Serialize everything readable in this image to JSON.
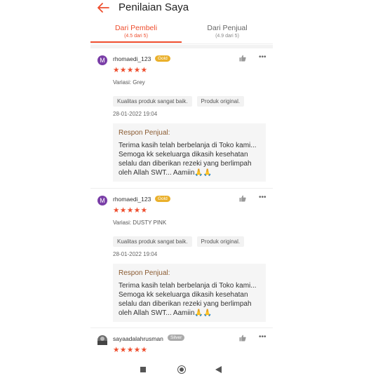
{
  "header": {
    "title": "Penilaian Saya"
  },
  "tabs": [
    {
      "label": "Dari Pembeli",
      "sub": "(4.5 dari 5)"
    },
    {
      "label": "Dari Penjual",
      "sub": "(4.9 dari 5)"
    }
  ],
  "colors": {
    "accent": "#ee4d2d",
    "gold": "#eab02b",
    "silver": "#aaaaaa"
  },
  "reviews": [
    {
      "avatar": "M",
      "user": "rhomaedi_123",
      "badge": "Gold",
      "stars": "★★★★★",
      "rating": 5,
      "variant": "Variasi: Grey",
      "tags": [
        "Kualitas produk sangat baik.",
        "Produk original."
      ],
      "date": "28-01-2022 19:04",
      "response_label": "Respon Penjual:",
      "response_text": "Terima kasih telah berbelanja di Toko kami... Semoga kk sekeluarga dikasih kesehatan selalu dan diberikan rezeki yang berlimpah oleh Allah SWT... Aamiin🙏🙏"
    },
    {
      "avatar": "M",
      "user": "rhomaedi_123",
      "badge": "Gold",
      "stars": "★★★★★",
      "rating": 5,
      "variant": "Variasi: DUSTY PINK",
      "tags": [
        "Kualitas produk sangat baik.",
        "Produk original."
      ],
      "date": "28-01-2022 19:04",
      "response_label": "Respon Penjual:",
      "response_text": "Terima kasih telah berbelanja di Toko kami... Semoga kk sekeluarga dikasih kesehatan selalu dan diberikan rezeki yang berlimpah oleh Allah SWT... Aamiin🙏🙏"
    },
    {
      "user": "sayaadalahrusman",
      "badge": "Silver",
      "stars": "★★★★★",
      "rating": 5
    }
  ],
  "more_glyph": "•••",
  "icons": {
    "back": "arrow-left-icon",
    "like": "thumbs-up-icon",
    "more": "more-dots-icon",
    "nav_recent": "square-icon",
    "nav_home": "circle-icon",
    "nav_back": "triangle-back-icon"
  }
}
